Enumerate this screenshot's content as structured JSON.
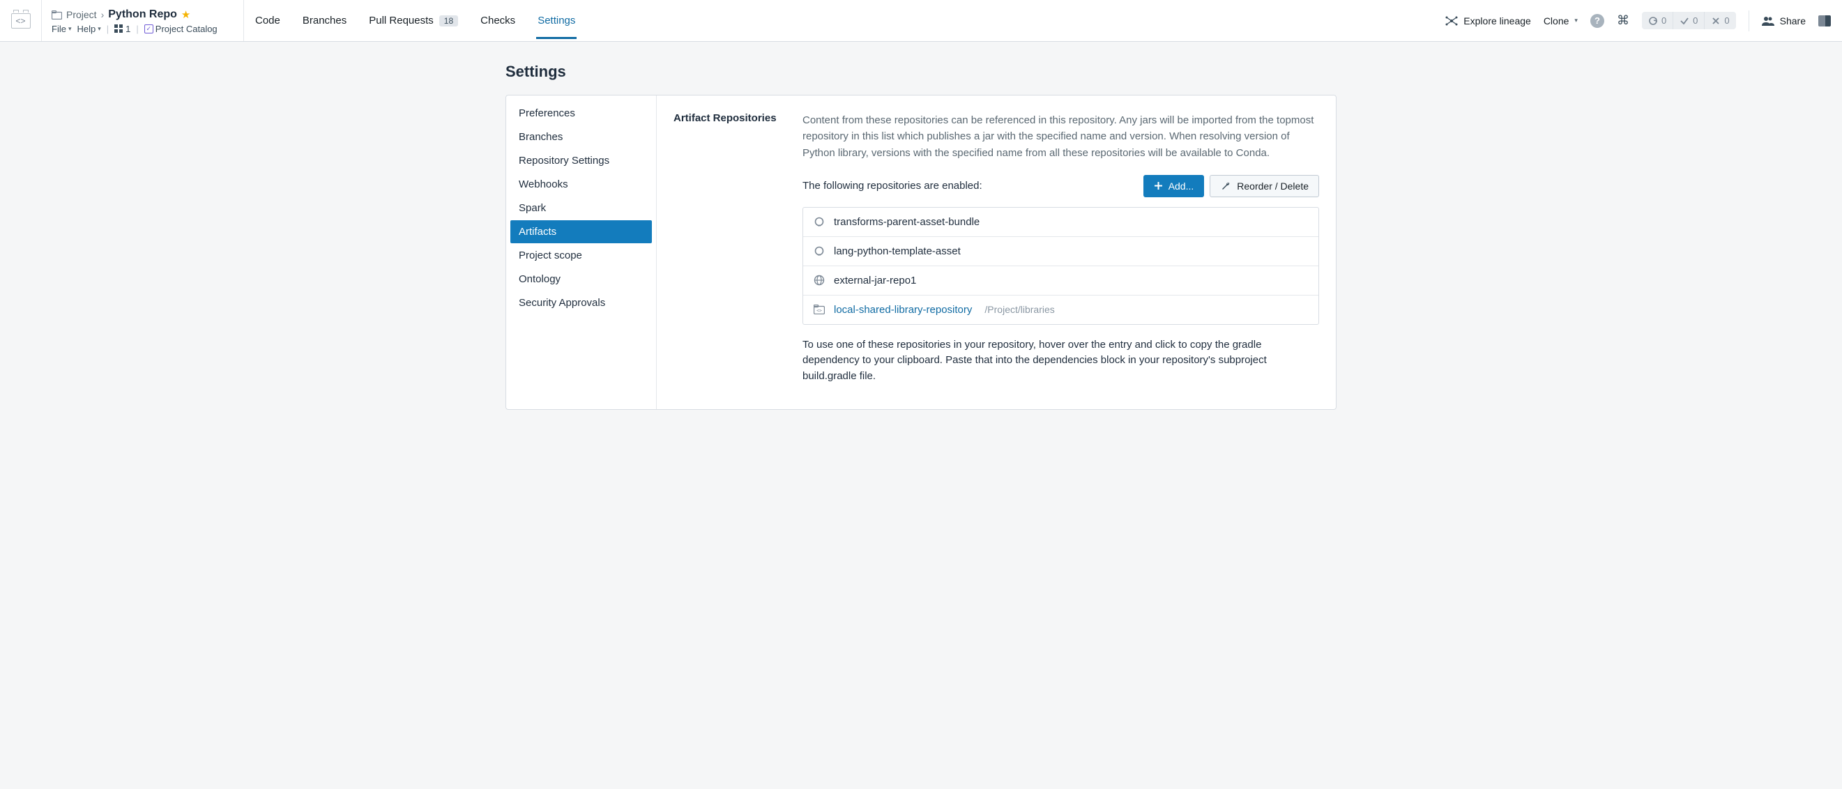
{
  "breadcrumb": {
    "parent": "Project",
    "repo_name": "Python Repo"
  },
  "menus": {
    "file": "File",
    "help": "Help",
    "branch_count": "1",
    "catalog": "Project Catalog"
  },
  "tabs": {
    "code": "Code",
    "branches": "Branches",
    "pull_requests": "Pull Requests",
    "pr_badge": "18",
    "checks": "Checks",
    "settings": "Settings"
  },
  "toolbar": {
    "explore_lineage": "Explore lineage",
    "clone": "Clone",
    "share": "Share"
  },
  "status": {
    "sync": "0",
    "pass": "0",
    "fail": "0"
  },
  "page": {
    "title": "Settings"
  },
  "sidenav": [
    "Preferences",
    "Branches",
    "Repository Settings",
    "Webhooks",
    "Spark",
    "Artifacts",
    "Project scope",
    "Ontology",
    "Security Approvals"
  ],
  "artifacts": {
    "heading": "Artifact Repositories",
    "description": "Content from these repositories can be referenced in this repository. Any jars will be imported from the topmost repository in this list which publishes a jar with the specified name and version. When resolving version of Python library, versions with the specified name from all these repositories will be available to Conda.",
    "enabled_text": "The following repositories are enabled:",
    "add_btn": "Add...",
    "reorder_btn": "Reorder / Delete",
    "repos": [
      {
        "name": "transforms-parent-asset-bundle",
        "icon": "bundle",
        "link": false,
        "path": ""
      },
      {
        "name": "lang-python-template-asset",
        "icon": "bundle",
        "link": false,
        "path": ""
      },
      {
        "name": "external-jar-repo1",
        "icon": "globe",
        "link": false,
        "path": ""
      },
      {
        "name": "local-shared-library-repository",
        "icon": "code-folder",
        "link": true,
        "path": "/Project/libraries"
      }
    ],
    "footer": "To use one of these repositories in your repository, hover over the entry and click to copy the gradle dependency to your clipboard. Paste that into the dependencies block in your repository's subproject build.gradle file."
  }
}
